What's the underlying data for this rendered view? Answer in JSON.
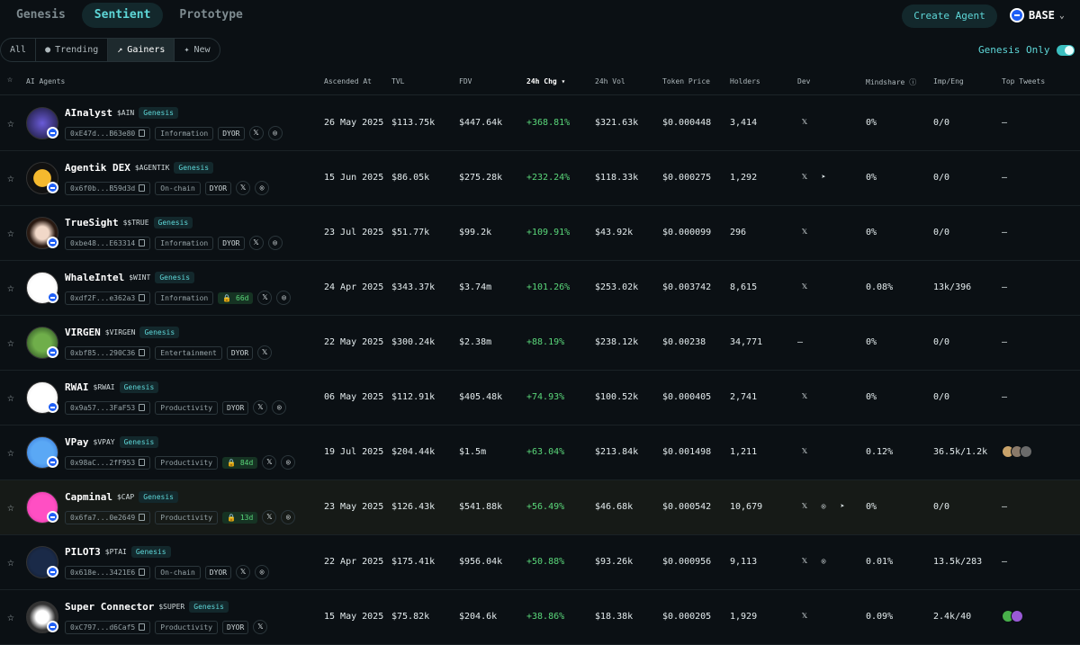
{
  "tabs": [
    "Genesis",
    "Sentient",
    "Prototype"
  ],
  "create_agent": "Create Agent",
  "chain": "BASE",
  "filters": [
    "All",
    "Trending",
    "Gainers",
    "New"
  ],
  "genesis_only": "Genesis Only",
  "headers": {
    "agents": "AI Agents",
    "ascended": "Ascended At",
    "tvl": "TVL",
    "fdv": "FDV",
    "chg": "24h Chg",
    "vol": "24h Vol",
    "price": "Token Price",
    "holders": "Holders",
    "dev": "Dev",
    "mindshare": "Mindshare",
    "imp": "Imp/Eng",
    "tweets": "Top Tweets"
  },
  "rows": [
    {
      "name": "AInalyst",
      "ticker": "$AIN",
      "tag": "Genesis",
      "addr": "0xE47d...B63e80",
      "cat": "Information",
      "dyor": "DYOR",
      "date": "26 May 2025",
      "tvl": "$113.75k",
      "fdv": "$447.64k",
      "chg": "+368.81%",
      "vol": "$321.63k",
      "price": "$0.000448",
      "holders": "3,414",
      "ms": "0%",
      "imp": "0/0",
      "tw": "–"
    },
    {
      "name": "Agentik DEX",
      "ticker": "$AGENTIK",
      "tag": "Genesis",
      "addr": "0x6f0b...B59d3d",
      "cat": "On-chain",
      "dyor": "DYOR",
      "date": "15 Jun 2025",
      "tvl": "$86.05k",
      "fdv": "$275.28k",
      "chg": "+232.24%",
      "vol": "$118.33k",
      "price": "$0.000275",
      "holders": "1,292",
      "ms": "0%",
      "imp": "0/0",
      "tw": "–"
    },
    {
      "name": "TrueSight",
      "ticker": "$$TRUE",
      "tag": "Genesis",
      "addr": "0xbe48...E63314",
      "cat": "Information",
      "dyor": "DYOR",
      "date": "23 Jul 2025",
      "tvl": "$51.77k",
      "fdv": "$99.2k",
      "chg": "+109.91%",
      "vol": "$43.92k",
      "price": "$0.000099",
      "holders": "296",
      "ms": "0%",
      "imp": "0/0",
      "tw": "–"
    },
    {
      "name": "WhaleIntel",
      "ticker": "$WINT",
      "tag": "Genesis",
      "addr": "0xdf2F...e362a3",
      "cat": "Information",
      "lock": "66d",
      "date": "24 Apr 2025",
      "tvl": "$343.37k",
      "fdv": "$3.74m",
      "chg": "+101.26%",
      "vol": "$253.02k",
      "price": "$0.003742",
      "holders": "8,615",
      "ms": "0.08%",
      "imp": "13k/396",
      "tw": "–"
    },
    {
      "name": "VIRGEN",
      "ticker": "$VIRGEN",
      "tag": "Genesis",
      "addr": "0xbf85...290C36",
      "cat": "Entertainment",
      "dyor": "DYOR",
      "date": "22 May 2025",
      "tvl": "$300.24k",
      "fdv": "$2.38m",
      "chg": "+88.19%",
      "vol": "$238.12k",
      "price": "$0.00238",
      "holders": "34,771",
      "dev": "–",
      "ms": "0%",
      "imp": "0/0",
      "tw": "–"
    },
    {
      "name": "RWAI",
      "ticker": "$RWAI",
      "tag": "Genesis",
      "addr": "0x9a57...3FaF53",
      "cat": "Productivity",
      "dyor": "DYOR",
      "date": "06 May 2025",
      "tvl": "$112.91k",
      "fdv": "$405.48k",
      "chg": "+74.93%",
      "vol": "$100.52k",
      "price": "$0.000405",
      "holders": "2,741",
      "ms": "0%",
      "imp": "0/0",
      "tw": "–"
    },
    {
      "name": "VPay",
      "ticker": "$VPAY",
      "tag": "Genesis",
      "addr": "0x98aC...2fF953",
      "cat": "Productivity",
      "lock": "84d",
      "date": "19 Jul 2025",
      "tvl": "$204.44k",
      "fdv": "$1.5m",
      "chg": "+63.04%",
      "vol": "$213.84k",
      "price": "$0.001498",
      "holders": "1,211",
      "ms": "0.12%",
      "imp": "36.5k/1.2k"
    },
    {
      "name": "Capminal",
      "ticker": "$CAP",
      "tag": "Genesis",
      "addr": "0x6fa7...0e2649",
      "cat": "Productivity",
      "lock": "13d",
      "date": "23 May 2025",
      "tvl": "$126.43k",
      "fdv": "$541.88k",
      "chg": "+56.49%",
      "vol": "$46.68k",
      "price": "$0.000542",
      "holders": "10,679",
      "ms": "0%",
      "imp": "0/0",
      "tw": "–"
    },
    {
      "name": "PILOT3",
      "ticker": "$PTAI",
      "tag": "Genesis",
      "addr": "0x618e...3421E6",
      "cat": "On-chain",
      "dyor": "DYOR",
      "date": "22 Apr 2025",
      "tvl": "$175.41k",
      "fdv": "$956.04k",
      "chg": "+50.88%",
      "vol": "$93.26k",
      "price": "$0.000956",
      "holders": "9,113",
      "ms": "0.01%",
      "imp": "13.5k/283",
      "tw": "–"
    },
    {
      "name": "Super Connector",
      "ticker": "$SUPER",
      "tag": "Genesis",
      "addr": "0xC797...d6Caf5",
      "cat": "Productivity",
      "dyor": "DYOR",
      "date": "15 May 2025",
      "tvl": "$75.82k",
      "fdv": "$204.6k",
      "chg": "+38.86%",
      "vol": "$18.38k",
      "price": "$0.000205",
      "holders": "1,929",
      "ms": "0.09%",
      "imp": "2.4k/40"
    }
  ],
  "colors": {
    "accent": "#5ed7d8",
    "positive": "#5ad77a",
    "background": "#0b1014"
  }
}
